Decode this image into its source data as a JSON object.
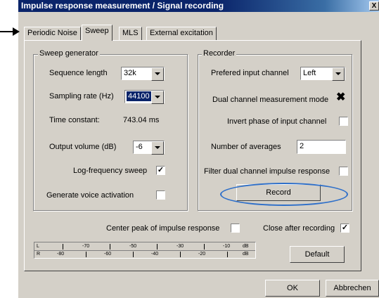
{
  "window": {
    "title": "Impulse response measurement / Signal recording",
    "close_glyph": "X"
  },
  "tabs": [
    "Periodic Noise",
    "Sweep",
    "MLS",
    "External excitation"
  ],
  "active_tab": "Sweep",
  "sweep_generator": {
    "title": "Sweep generator",
    "sequence_length": {
      "label": "Sequence length",
      "value": "32k"
    },
    "sampling_rate": {
      "label": "Sampling rate (Hz)",
      "value": "44100"
    },
    "time_constant": {
      "label": "Time constant:",
      "value": "743.04 ms"
    },
    "output_volume": {
      "label": "Output volume (dB)",
      "value": "-6"
    },
    "log_frequency_sweep": {
      "label": "Log-frequency sweep",
      "checked": true
    },
    "voice_activation": {
      "label": "Generate voice activation",
      "checked": false
    }
  },
  "recorder": {
    "title": "Recorder",
    "preferred_input_channel": {
      "label": "Prefered input channel",
      "value": "Left"
    },
    "dual_channel_mode": {
      "label": "Dual channel measurement mode",
      "checked": true
    },
    "invert_phase": {
      "label": "Invert phase of input channel",
      "checked": false
    },
    "number_of_averages": {
      "label": "Number of averages",
      "value": "2"
    },
    "filter_dual_channel": {
      "label": "Filter dual channel impulse response",
      "checked": false
    },
    "record_button": "Record"
  },
  "center_peak": {
    "label": "Center peak of impulse response",
    "checked": false
  },
  "close_after_recording": {
    "label": "Close after recording",
    "checked": true
  },
  "level_meter": {
    "left": {
      "channel": "L",
      "scale": [
        "-70",
        "-50",
        "-30",
        "-10"
      ],
      "unit": "dB"
    },
    "right": {
      "channel": "R",
      "scale": [
        "-80",
        "-60",
        "-40",
        "-20"
      ],
      "unit": "dB"
    }
  },
  "buttons": {
    "default": "Default",
    "ok": "OK",
    "cancel": "Abbrechen"
  },
  "colors": {
    "title_bar": "#0a246a",
    "face": "#d4d0c8",
    "highlight_ellipse": "#2e6fc9",
    "pointer_arrow": "#000000"
  },
  "icons": {
    "pointer": "arrow-right-icon",
    "check": "checkmark-icon"
  }
}
